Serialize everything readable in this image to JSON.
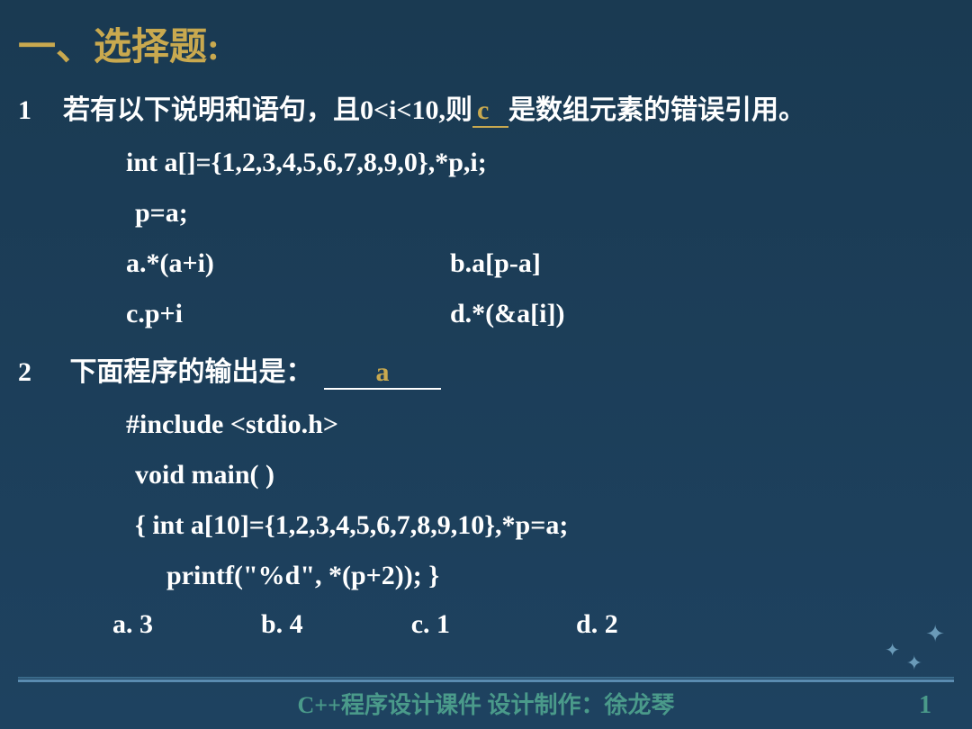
{
  "title": "一、选择题:",
  "q1": {
    "num": "1",
    "text_before": "若有以下说明和语句，且0<i<10,则",
    "answer": "c",
    "text_after": "是数组元素的错误引用",
    "code1": "int a[]={1,2,3,4,5,6,7,8,9,0},*p,i;",
    "code2": "p=a;",
    "opt_a": "a.*(a+i)",
    "opt_b": "b.a[p-a]",
    "opt_c": "c.p+i",
    "opt_d": "d.*(&a[i])"
  },
  "q2": {
    "num": "2",
    "text": "下面程序的输出是：",
    "answer": "a",
    "code1": "#include <stdio.h>",
    "code2": "void main( )",
    "code3": "{  int a[10]={1,2,3,4,5,6,7,8,9,10},*p=a;",
    "code4": "printf(\"%d\", *(p+2)); }",
    "opt_a": "a. 3",
    "opt_b": "b. 4",
    "opt_c": "c. 1",
    "opt_d": "d. 2"
  },
  "footer": "C++程序设计课件    设计制作：徐龙琴",
  "page": "1"
}
